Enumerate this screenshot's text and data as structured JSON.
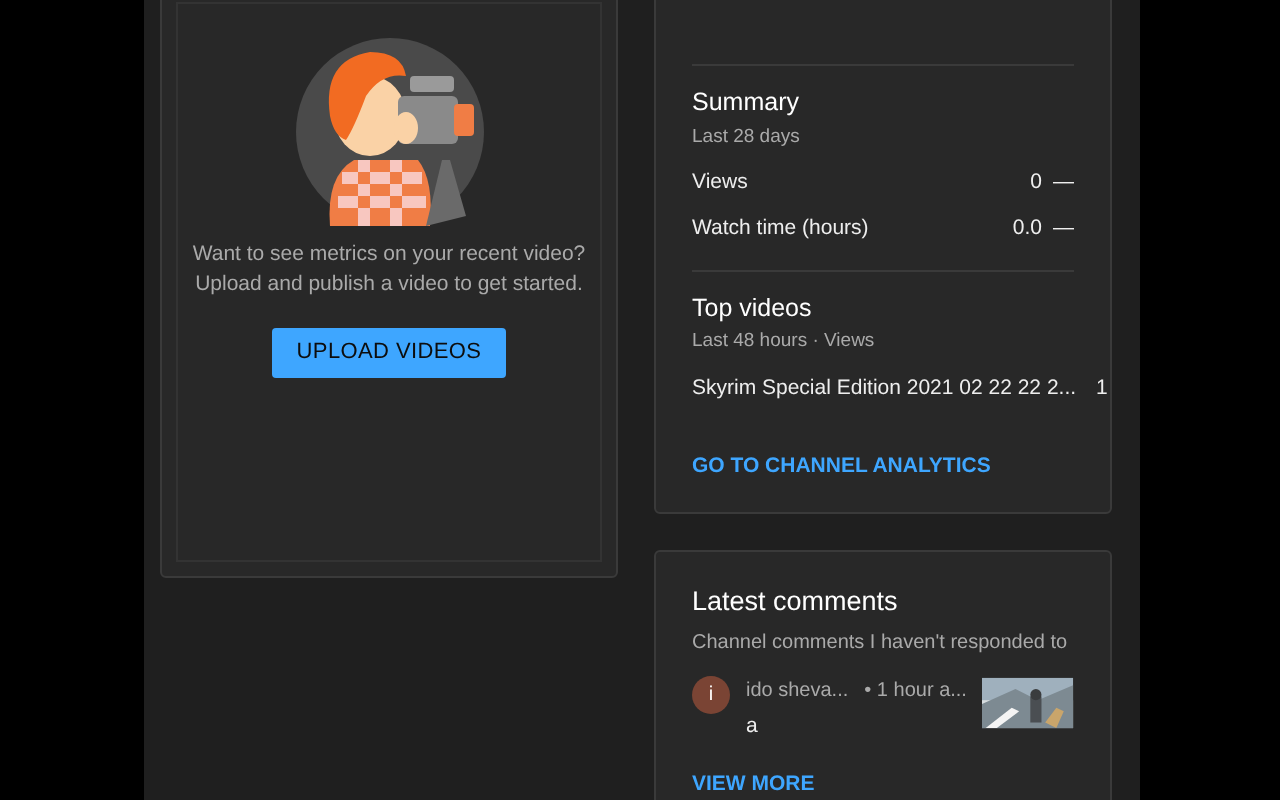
{
  "upload_card": {
    "message_lines": [
      "Want to see metrics on your recent video?",
      "Upload and publish a video to get started."
    ],
    "button": "UPLOAD VIDEOS"
  },
  "summary": {
    "title": "Summary",
    "subtitle": "Last 28 days",
    "metrics": [
      {
        "label": "Views",
        "value": "0",
        "trend": "—"
      },
      {
        "label": "Watch time (hours)",
        "value": "0.0",
        "trend": "—"
      }
    ]
  },
  "top_videos": {
    "title": "Top videos",
    "subtitle": "Last 48 hours · Views",
    "videos": [
      {
        "title": "Skyrim Special Edition 2021 02 22 22 2...",
        "views": "1"
      }
    ],
    "link": "GO TO CHANNEL ANALYTICS"
  },
  "latest_comments": {
    "title": "Latest comments",
    "subtitle": "Channel comments I haven't responded to",
    "comments": [
      {
        "avatar": "i",
        "author": "ido sheva...",
        "time": "• 1 hour a...",
        "text": "a"
      }
    ],
    "link": "VIEW MORE"
  }
}
